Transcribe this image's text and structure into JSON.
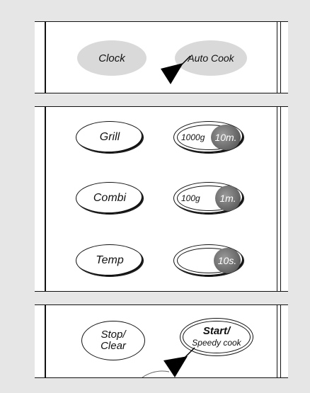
{
  "panel_top": {
    "clock_label": "Clock",
    "auto_cook_label": "Auto Cook"
  },
  "panel_middle": {
    "grill_label": "Grill",
    "combi_label": "Combi",
    "temp_label": "Temp",
    "weight_1000g": "1000g",
    "time_10m": "10m.",
    "weight_100g": "100g",
    "time_1m": "1m.",
    "time_10s": "10s."
  },
  "panel_bottom": {
    "stop_label_1": "Stop/",
    "stop_label_2": "Clear",
    "start_label_1": "Start/",
    "start_label_2": "Speedy cook"
  },
  "colors": {
    "background": "#e6e6e6",
    "panel": "#ffffff",
    "gray_button": "#d9d9d9",
    "line": "#111111"
  },
  "icons": [
    "pointer-arrow-icon"
  ]
}
